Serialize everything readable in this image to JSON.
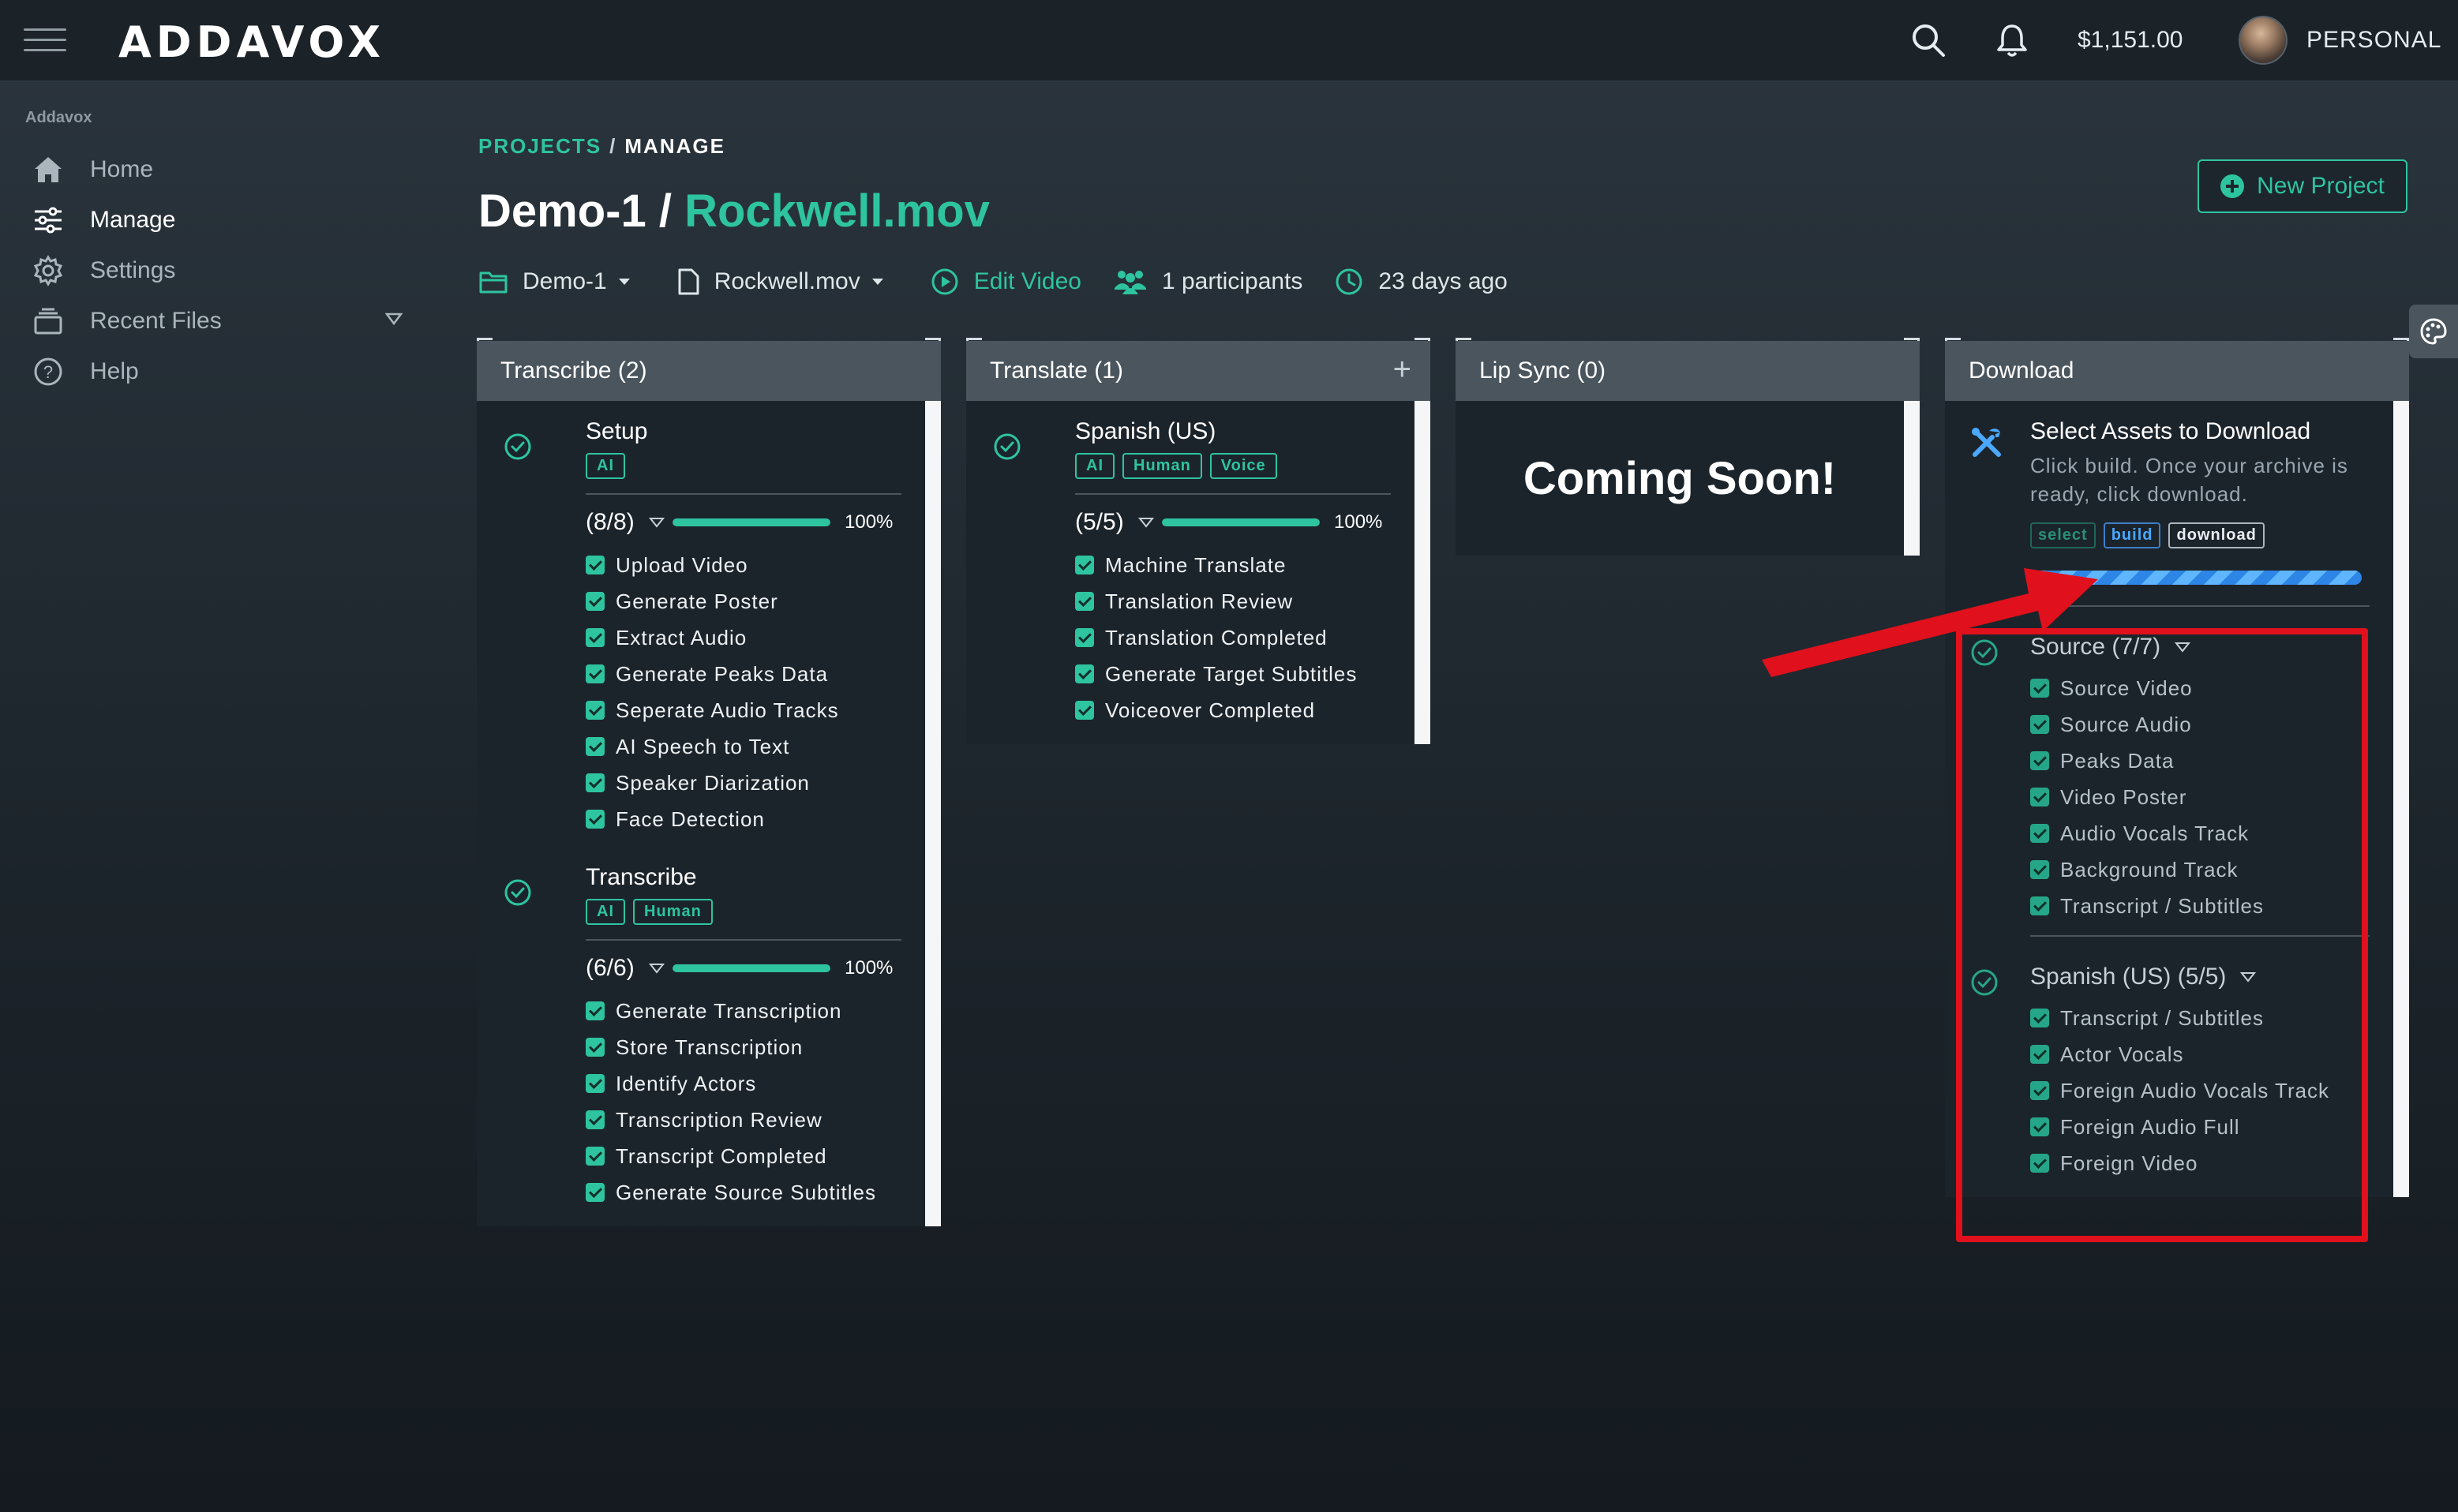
{
  "app": {
    "brand": "ADDAVOX",
    "balance": "$1,151.00",
    "account_label": "PERSONAL"
  },
  "icons": {
    "menu": "hamburger-icon",
    "search": "search-icon",
    "notifications": "bell-icon",
    "home": "home-icon",
    "manage": "sliders-icon",
    "settings": "gear-icon",
    "recent": "stack-icon",
    "help": "help-circle-icon",
    "folder": "folder-icon",
    "file": "file-icon",
    "play": "play-circle-icon",
    "participants": "users-icon",
    "time": "clock-icon",
    "palette": "palette-icon",
    "tools": "tools-icon",
    "check": "check-circle-icon"
  },
  "colors": {
    "accent": "#2ec4a0",
    "build": "#4aa8ff",
    "annotation": "#e0101c"
  },
  "sidebar": {
    "title": "Addavox",
    "items": [
      {
        "label": "Home"
      },
      {
        "label": "Manage"
      },
      {
        "label": "Settings"
      },
      {
        "label": "Recent Files"
      },
      {
        "label": "Help"
      }
    ]
  },
  "header": {
    "crumb_projects": "PROJECTS",
    "crumb_sep": "/",
    "crumb_manage": "MANAGE",
    "title_project": "Demo-1 /",
    "title_file": "Rockwell.mov",
    "new_project": "New Project",
    "meta": {
      "project": "Demo-1",
      "file": "Rockwell.mov",
      "edit_video": "Edit Video",
      "participants": "1 participants",
      "time": "23 days ago"
    }
  },
  "columns": {
    "transcribe": {
      "title": "Transcribe (2)",
      "cards": [
        {
          "title": "Setup",
          "tags": [
            "AI"
          ],
          "count": "(8/8)",
          "progress": 1.0,
          "pct": "100%",
          "items": [
            "Upload Video",
            "Generate Poster",
            "Extract Audio",
            "Generate Peaks Data",
            "Seperate Audio Tracks",
            "AI Speech to Text",
            "Speaker Diarization",
            "Face Detection"
          ]
        },
        {
          "title": "Transcribe",
          "tags": [
            "AI",
            "Human"
          ],
          "count": "(6/6)",
          "progress": 1.0,
          "pct": "100%",
          "items": [
            "Generate Transcription",
            "Store Transcription",
            "Identify Actors",
            "Transcription Review",
            "Transcript Completed",
            "Generate Source Subtitles"
          ]
        }
      ]
    },
    "translate": {
      "title": "Translate (1)",
      "plus": "+",
      "card": {
        "title": "Spanish (US)",
        "tags": [
          "AI",
          "Human",
          "Voice"
        ],
        "count": "(5/5)",
        "progress": 1.0,
        "pct": "100%",
        "items": [
          "Machine Translate",
          "Translation Review",
          "Translation Completed",
          "Generate Target Subtitles",
          "Voiceover Completed"
        ]
      }
    },
    "lipsync": {
      "title": "Lip Sync (0)",
      "message": "Coming Soon!"
    },
    "download": {
      "title": "Download",
      "heading": "Select Assets to Download",
      "description": "Click build. Once your archive is ready, click download.",
      "buttons": {
        "select": "select",
        "build": "build",
        "download": "download"
      },
      "sections": [
        {
          "title": "Source (7/7)",
          "items": [
            "Source Video",
            "Source Audio",
            "Peaks Data",
            "Video Poster",
            "Audio Vocals Track",
            "Background Track",
            "Transcript / Subtitles"
          ]
        },
        {
          "title": "Spanish (US) (5/5)",
          "items": [
            "Transcript / Subtitles",
            "Actor Vocals",
            "Foreign Audio Vocals Track",
            "Foreign Audio Full",
            "Foreign Video"
          ]
        }
      ]
    }
  }
}
